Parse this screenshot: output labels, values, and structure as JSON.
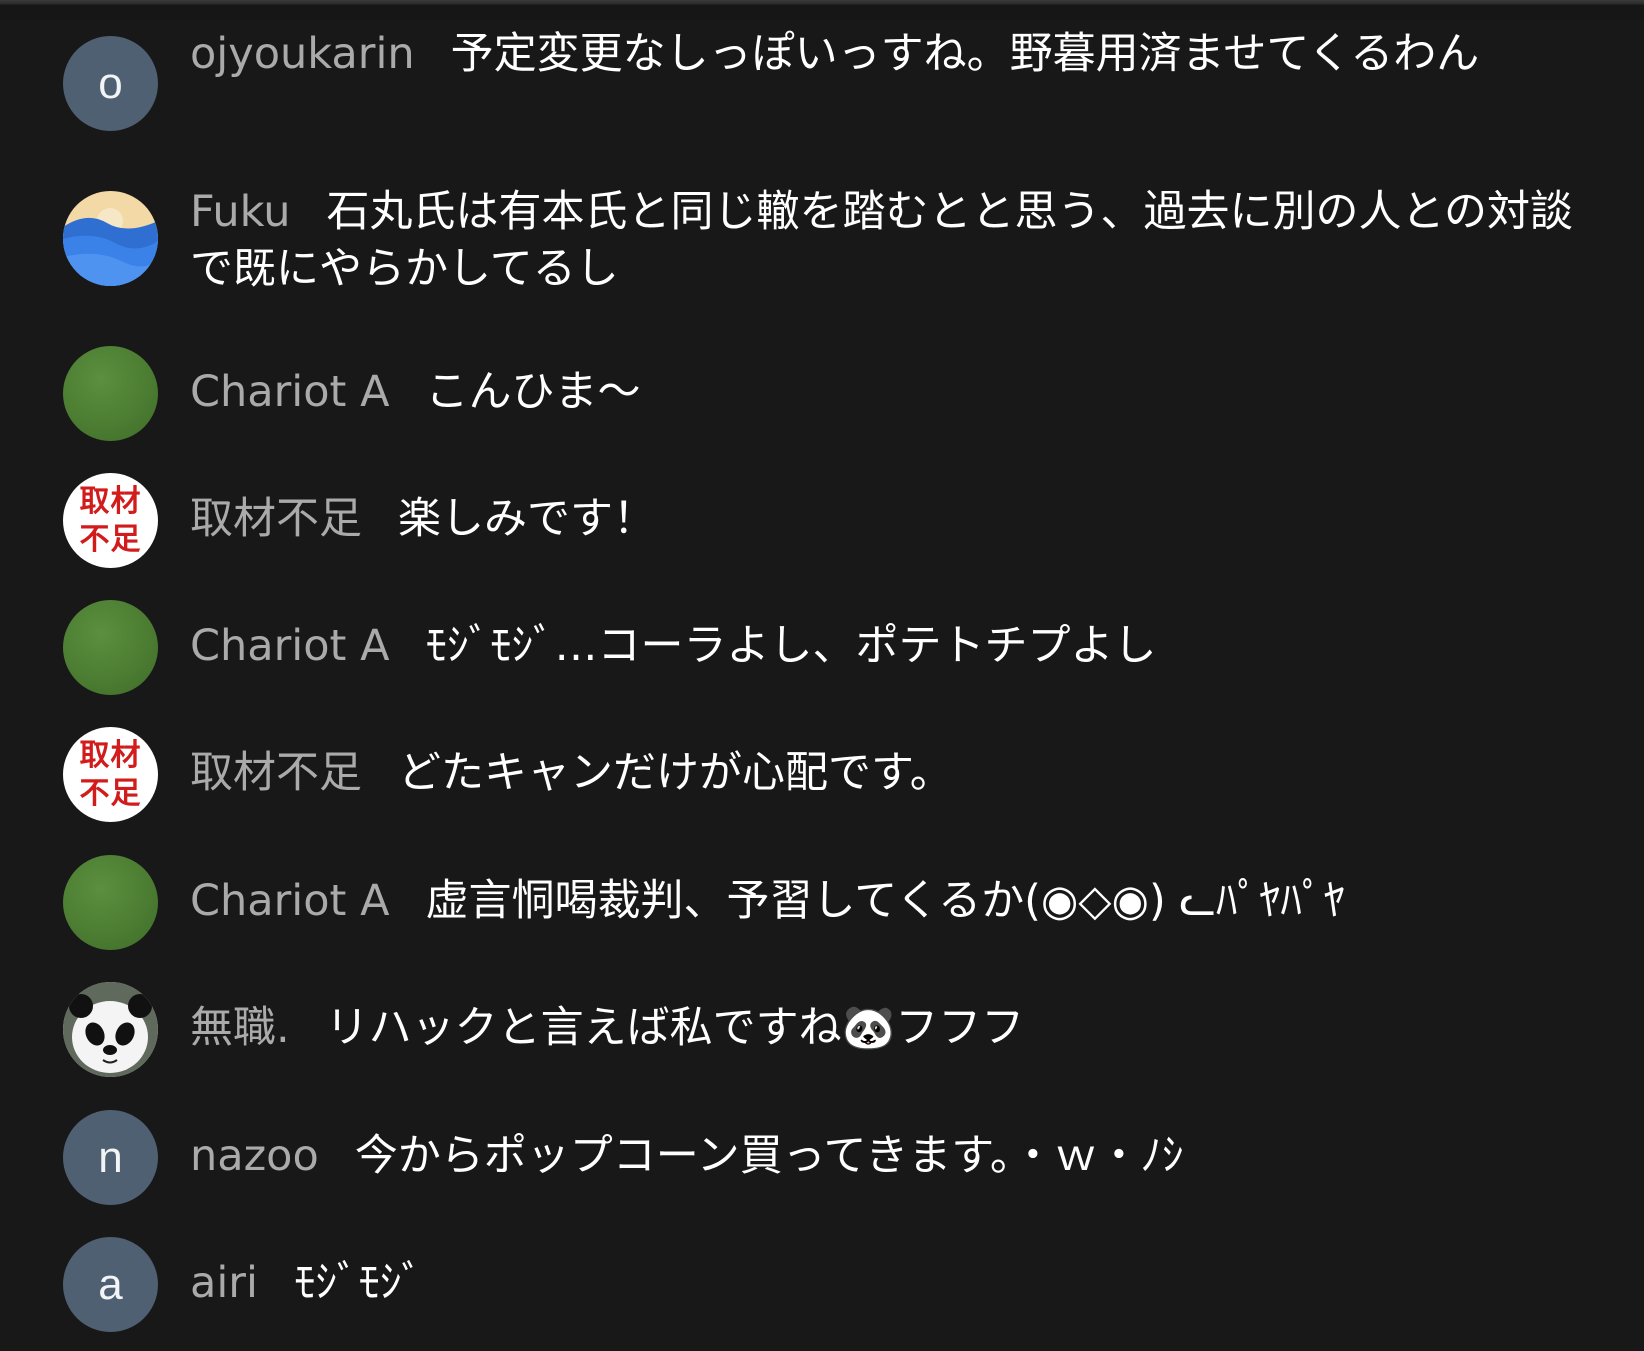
{
  "messages": [
    {
      "avatar_type": "letter",
      "avatar_letter": "o",
      "author": "ojyoukarin",
      "text": "予定変更なしっぽいっすね。野暮用済ませてくるわん"
    },
    {
      "avatar_type": "landscape-icon",
      "author": "Fuku",
      "text": "石丸氏は有本氏と同じ轍を踏むとと思う、過去に別の人との対談で既にやらかしてるし"
    },
    {
      "avatar_type": "green-circle",
      "author": "Chariot A",
      "text": "こんひま〜"
    },
    {
      "avatar_type": "kanji",
      "avatar_line1": "取材",
      "avatar_line2": "不足",
      "author": "取材不足",
      "text": "楽しみです！"
    },
    {
      "avatar_type": "green-circle",
      "author": "Chariot A",
      "text": "ﾓｼﾞﾓｼﾞ…コーラよし、ポテトチプよし"
    },
    {
      "avatar_type": "kanji",
      "avatar_line1": "取材",
      "avatar_line2": "不足",
      "author": "取材不足",
      "text": "どたキャンだけが心配です。"
    },
    {
      "avatar_type": "green-circle",
      "author": "Chariot A",
      "text": "虚言恫喝裁判、予習してくるか(◉◇◉) ᓚﾊﾟﾔﾊﾟﾔ"
    },
    {
      "avatar_type": "panda-icon",
      "author": "無職.",
      "text": "リハックと言えば私ですね🐼フフフ"
    },
    {
      "avatar_type": "letter",
      "avatar_letter": "n",
      "author": "nazoo",
      "text": "今からポップコーン買ってきます。・ｗ・ﾉｼ"
    },
    {
      "avatar_type": "letter",
      "avatar_letter": "a",
      "author": "airi",
      "text": "ﾓｼﾞﾓｼﾞ"
    }
  ],
  "colors": {
    "background": "#181818",
    "author": "#aaaaaa",
    "message": "#ffffff",
    "letter_avatar_bg": "#4f6072",
    "kanji_avatar_text": "#d21b1b"
  }
}
